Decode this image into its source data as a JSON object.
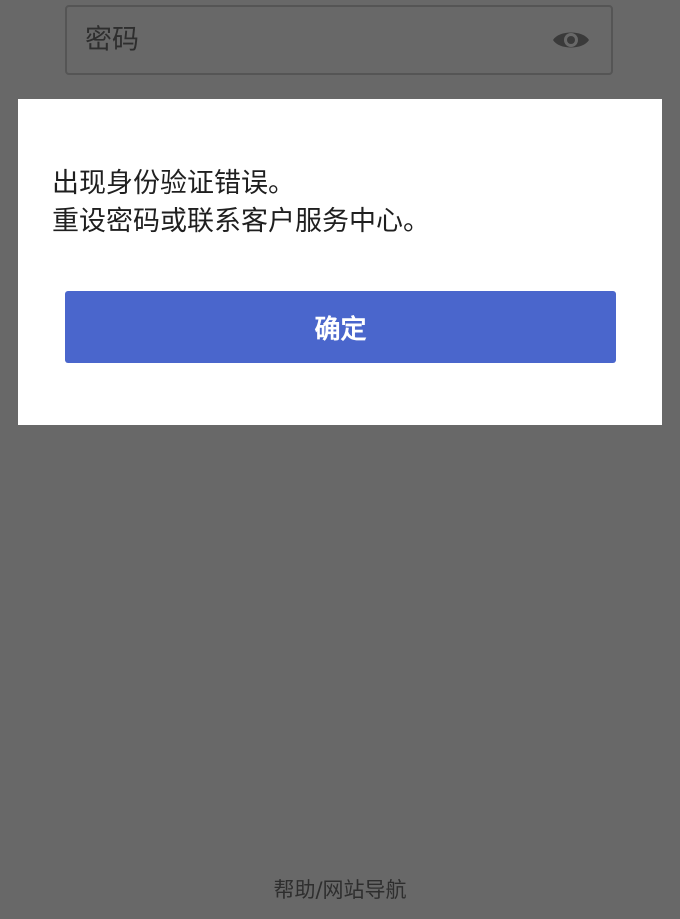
{
  "login": {
    "password_placeholder": "密码",
    "reveal_icon": "eye-icon"
  },
  "dialog": {
    "message_line1": "出现身份验证错误。",
    "message_line2": "重设密码或联系客户服务中心。",
    "confirm_label": "确定"
  },
  "footer": {
    "link_label": "帮助/网站导航"
  },
  "colors": {
    "overlay": "#686868",
    "dialog_bg": "#ffffff",
    "primary_button": "#4a66cc",
    "text": "#1f1f1f"
  }
}
